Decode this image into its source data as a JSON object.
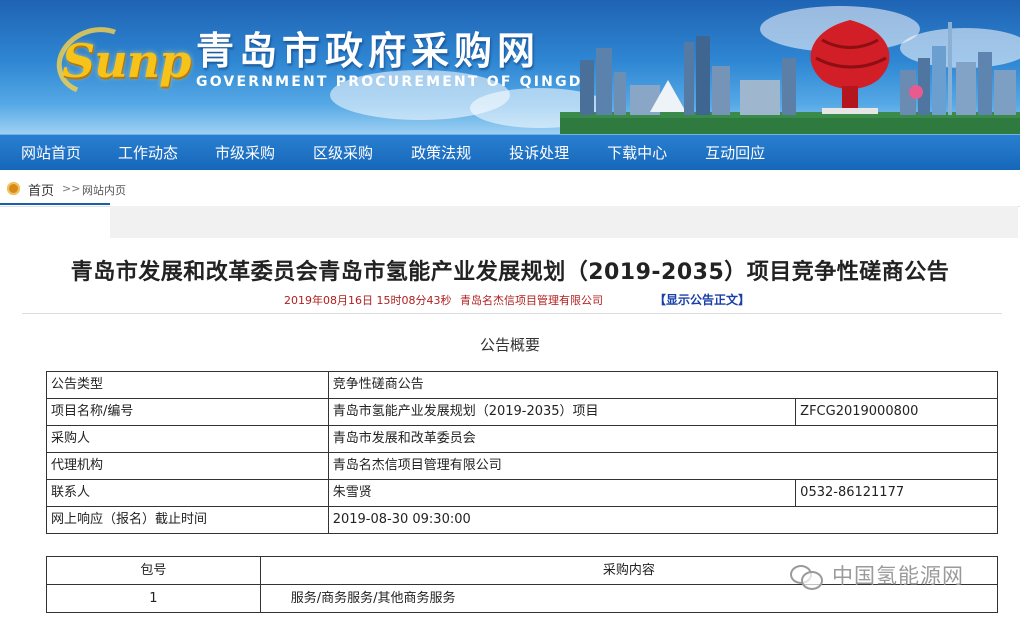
{
  "header": {
    "logo_text": "Sunp",
    "title": "青岛市政府采购网",
    "subtitle": "GOVERNMENT PROCUREMENT OF QINGDAO"
  },
  "nav": {
    "items": [
      "网站首页",
      "工作动态",
      "市级采购",
      "区级采购",
      "政策法规",
      "投诉处理",
      "下载中心",
      "互动回应"
    ]
  },
  "breadcrumb": {
    "home": "首页",
    "separator": ">>",
    "current": "网站内页"
  },
  "article": {
    "title": "青岛市发展和改革委员会青岛市氢能产业发展规划（2019-2035）项目竞争性磋商公告",
    "date": "2019年08月16日 15时08分43秒",
    "publisher": "青岛名杰信项目管理有限公司",
    "show_text_link": "【显示公告正文】",
    "section_heading": "公告概要"
  },
  "summary_table": {
    "type_label": "公告类型",
    "type_value": "竞争性磋商公告",
    "project_label": "项目名称/编号",
    "project_name": "青岛市氢能产业发展规划（2019-2035）项目",
    "project_code": "ZFCG2019000800",
    "purchaser_label": "采购人",
    "purchaser_value": "青岛市发展和改革委员会",
    "agency_label": "代理机构",
    "agency_value": "青岛名杰信项目管理有限公司",
    "contact_label": "联系人",
    "contact_name": "朱雪贤",
    "contact_phone": "0532-86121177",
    "deadline_label": "网上响应（报名）截止时间",
    "deadline_value": "2019-08-30 09:30:00"
  },
  "package_table": {
    "col_package": "包号",
    "col_content": "采购内容",
    "rows": [
      {
        "package": "1",
        "content": "服务/商务服务/其他商务服务"
      }
    ]
  },
  "watermark": {
    "text": "中国氢能源网",
    "icon": "wechat-icon"
  },
  "colors": {
    "banner": "#2e86d2",
    "nav": "#1566b8",
    "meta_red": "#b01e1e",
    "link_blue": "#1a3fa8",
    "logo_gold": "#f7c21a"
  }
}
